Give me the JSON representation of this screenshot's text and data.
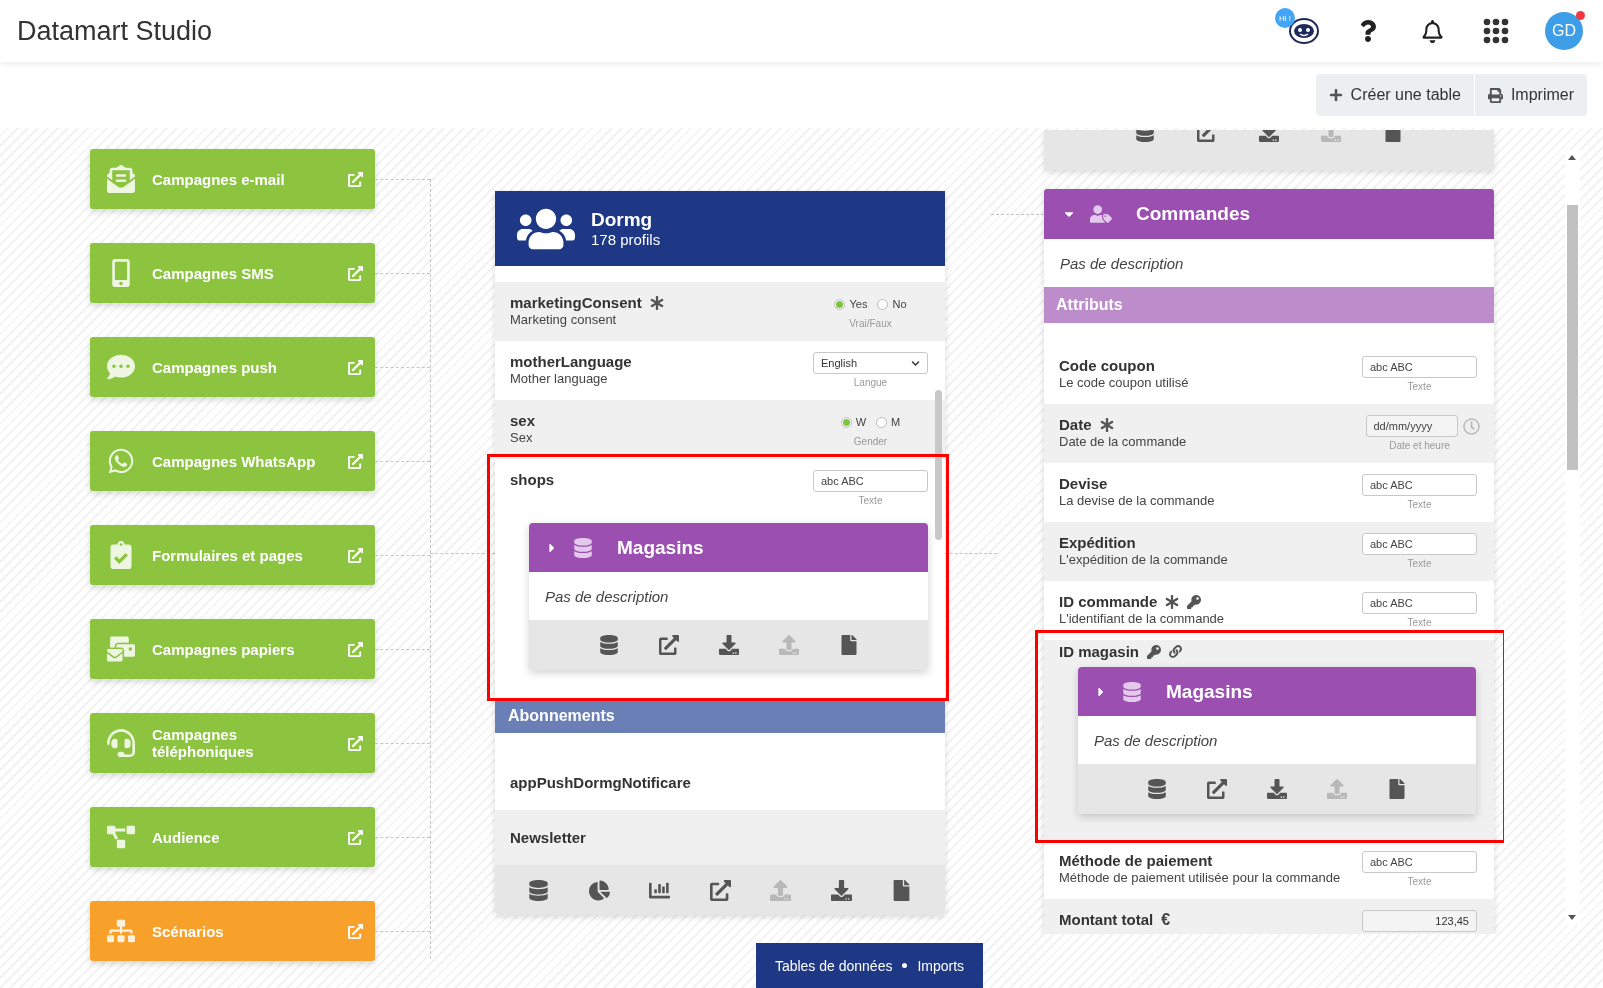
{
  "header": {
    "title": "Datamart Studio",
    "assistant_badge": "Hi !",
    "avatar_initials": "GD",
    "has_notification": true
  },
  "toolbar": [
    {
      "kind": "create",
      "label": "Créer une table"
    },
    {
      "kind": "print",
      "label": "Imprimer"
    }
  ],
  "channels": [
    {
      "kind": "email",
      "label": "Campagnes e-mail",
      "color": "#8cc43f"
    },
    {
      "kind": "sms",
      "label": "Campagnes SMS",
      "color": "#8cc43f"
    },
    {
      "kind": "push",
      "label": "Campagnes push",
      "color": "#8cc43f"
    },
    {
      "kind": "whatsapp",
      "label": "Campagnes WhatsApp",
      "color": "#8cc43f"
    },
    {
      "kind": "forms",
      "label": "Formulaires et pages",
      "color": "#8cc43f"
    },
    {
      "kind": "paper",
      "label": "Campagnes papiers",
      "color": "#8cc43f"
    },
    {
      "kind": "phone",
      "label": "Campagnes téléphoniques",
      "color": "#8cc43f"
    },
    {
      "kind": "audience",
      "label": "Audience",
      "color": "#8cc43f"
    },
    {
      "kind": "scenarios",
      "label": "Scénarios",
      "color": "#f8a12a"
    }
  ],
  "profile_table": {
    "title": "Dormg",
    "subtitle": "178 profils",
    "fields": [
      {
        "kind": "radio",
        "name": "marketingConsent",
        "description": "Marketing consent",
        "required": true,
        "options": [
          {
            "label": "Yes",
            "selected": true
          },
          {
            "label": "No",
            "selected": false
          }
        ],
        "type_label": "Vrai/Faux"
      },
      {
        "kind": "select",
        "name": "motherLanguage",
        "description": "Mother language",
        "value": "English",
        "type_label": "Langue"
      },
      {
        "kind": "radio",
        "name": "sex",
        "description": "Sex",
        "options": [
          {
            "label": "W",
            "selected": true
          },
          {
            "label": "M",
            "selected": false
          }
        ],
        "type_label": "Gender"
      },
      {
        "kind": "text",
        "name": "shops",
        "placeholder": "abc ABC",
        "type_label": "Texte",
        "linked_table": {
          "title": "Magasins",
          "description": "Pas de description",
          "expanded": false,
          "highlighted": true,
          "actions": [
            {
              "kind": "database",
              "disabled": false
            },
            {
              "kind": "open",
              "disabled": false
            },
            {
              "kind": "download",
              "disabled": false
            },
            {
              "kind": "upload",
              "disabled": true
            },
            {
              "kind": "file",
              "disabled": false
            }
          ]
        }
      }
    ],
    "sections": [
      {
        "title": "Abonnements",
        "items": [
          {
            "name": "appPushDormgNotificare"
          },
          {
            "name": "Newsletter"
          }
        ]
      }
    ],
    "actions": [
      {
        "kind": "database",
        "disabled": false
      },
      {
        "kind": "pie",
        "disabled": false
      },
      {
        "kind": "bars",
        "disabled": false
      },
      {
        "kind": "open",
        "disabled": false
      },
      {
        "kind": "upload",
        "disabled": true
      },
      {
        "kind": "download",
        "disabled": false
      },
      {
        "kind": "file",
        "disabled": false
      }
    ]
  },
  "related_column": {
    "previous_actions": [
      {
        "kind": "database",
        "disabled": false
      },
      {
        "kind": "open",
        "disabled": false
      },
      {
        "kind": "download",
        "disabled": false
      },
      {
        "kind": "upload",
        "disabled": true
      },
      {
        "kind": "file",
        "disabled": false
      }
    ],
    "table": {
      "title": "Commandes",
      "expanded": true,
      "description": "Pas de description",
      "section": "Attributs",
      "fields": [
        {
          "kind": "text",
          "name": "Code coupon",
          "description": "Le code coupon utilisé",
          "placeholder": "abc ABC",
          "type_label": "Texte"
        },
        {
          "kind": "date",
          "name": "Date",
          "description": "Date de la commande",
          "required": true,
          "placeholder": "dd/mm/yyyy",
          "type_label": "Date et heure"
        },
        {
          "kind": "text",
          "name": "Devise",
          "description": "La devise de la commande",
          "placeholder": "abc ABC",
          "type_label": "Texte"
        },
        {
          "kind": "text",
          "name": "Expédition",
          "description": "L'expédition de la commande",
          "placeholder": "abc ABC",
          "type_label": "Texte"
        },
        {
          "kind": "text",
          "name": "ID commande",
          "description": "L'identifiant de la commande",
          "required": true,
          "key": true,
          "placeholder": "abc ABC",
          "type_label": "Texte"
        },
        {
          "kind": "plain",
          "name": "ID magasin",
          "key": true,
          "linked": true,
          "linked_table": {
            "title": "Magasins",
            "description": "Pas de description",
            "expanded": false,
            "highlighted": true,
            "actions": [
              {
                "kind": "database",
                "disabled": false
              },
              {
                "kind": "open",
                "disabled": false
              },
              {
                "kind": "download",
                "disabled": false
              },
              {
                "kind": "upload",
                "disabled": true
              },
              {
                "kind": "file",
                "disabled": false
              }
            ]
          }
        },
        {
          "kind": "text",
          "name": "Méthode de paiement",
          "description": "Méthode de paiement utilisée pour la commande",
          "placeholder": "abc ABC",
          "type_label": "Texte"
        },
        {
          "kind": "number",
          "name": "Montant total",
          "currency": "€",
          "value": "123,45"
        }
      ]
    }
  },
  "bottom_tabs": [
    {
      "label": "Tables de données"
    },
    {
      "label": "Imports"
    }
  ]
}
